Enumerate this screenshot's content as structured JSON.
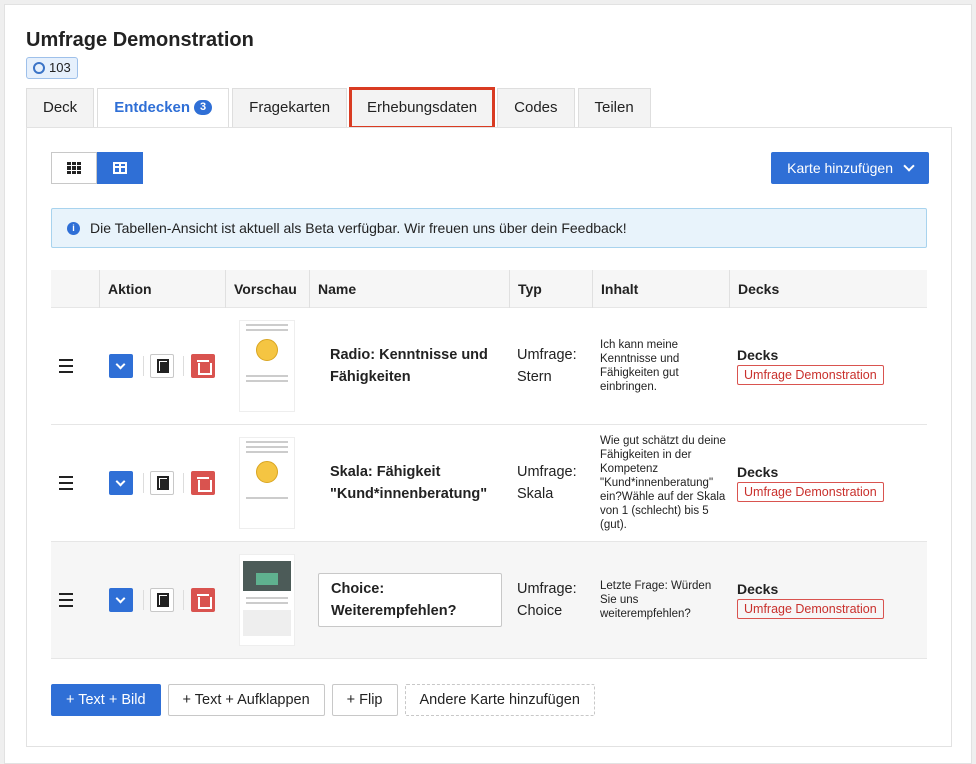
{
  "header": {
    "title": "Umfrage Demonstration",
    "id_badge": "103"
  },
  "tabs": [
    {
      "label": "Deck"
    },
    {
      "label": "Entdecken",
      "count": "3"
    },
    {
      "label": "Fragekarten"
    },
    {
      "label": "Erhebungsdaten"
    },
    {
      "label": "Codes"
    },
    {
      "label": "Teilen"
    }
  ],
  "toolbar": {
    "add_card_label": "Karte hinzufügen"
  },
  "info": {
    "text": "Die Tabellen-Ansicht ist aktuell als Beta verfügbar. Wir freuen uns über dein Feedback!"
  },
  "table": {
    "headers": [
      "Aktion",
      "Vorschau",
      "Name",
      "Typ",
      "Inhalt",
      "Decks"
    ],
    "rows": [
      {
        "name": "Radio: Kenntnisse und Fähigkeiten",
        "type": "Umfrage: Stern",
        "content": "Ich kann meine Kenntnisse und Fähigkeiten gut einbringen.",
        "decks_label": "Decks",
        "deck_tag": "Umfrage Demonstration"
      },
      {
        "name": "Skala: Fähigkeit \"Kund*innenberatung\"",
        "type": "Umfrage: Skala",
        "content": "Wie gut schätzt du deine Fähigkeiten in der Kompetenz \"Kund*innenberatung\" ein?Wähle auf der Skala von 1 (schlecht) bis 5 (gut).",
        "decks_label": "Decks",
        "deck_tag": "Umfrage Demonstration"
      },
      {
        "name": "Choice: Weiterempfehlen?",
        "type": "Umfrage: Choice",
        "content": "Letzte Frage: Würden Sie uns weiterempfehlen?",
        "decks_label": "Decks",
        "deck_tag": "Umfrage Demonstration"
      }
    ]
  },
  "bottom_buttons": {
    "text_bild": "+ Text + Bild",
    "text_aufklappen": "+ Text + Aufklappen",
    "flip": "+ Flip",
    "andere": "Andere Karte hinzufügen"
  }
}
